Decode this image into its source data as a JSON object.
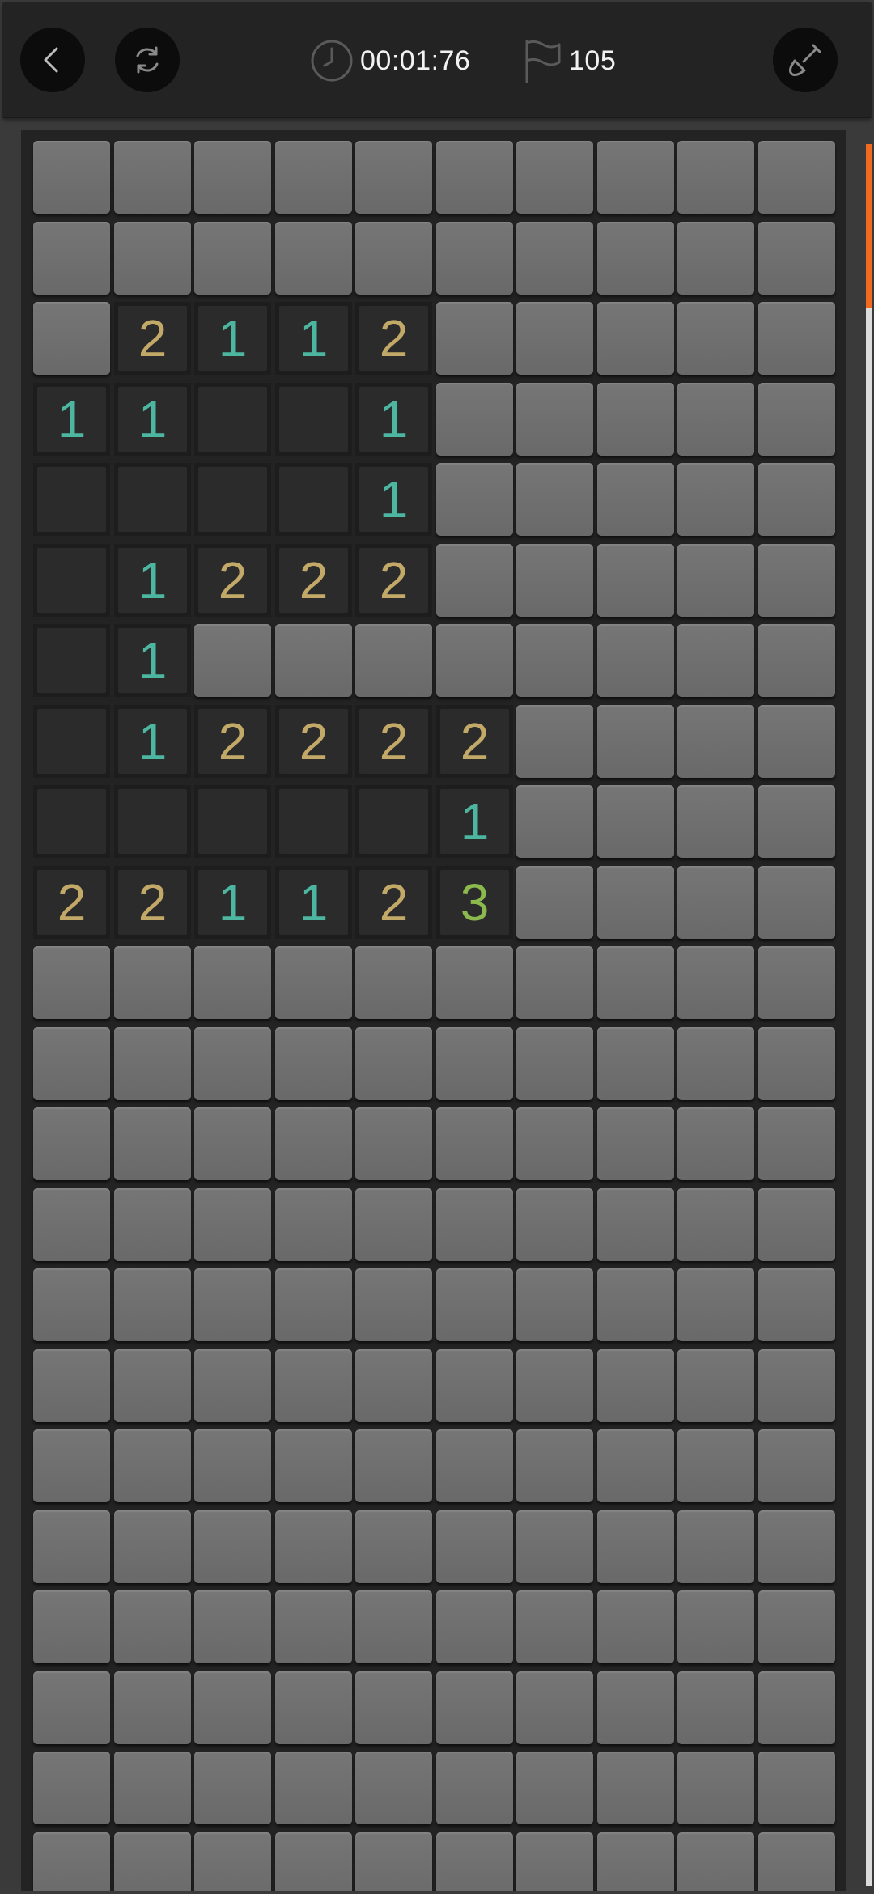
{
  "header": {
    "timer": "00:01:76",
    "flags": "105",
    "icons": {
      "back": "back-arrow-icon",
      "restart": "restart-icon",
      "dig": "shovel-icon",
      "clock": "clock-icon",
      "flag": "flag-icon"
    }
  },
  "board": {
    "cols": 10,
    "visible_rows": 23,
    "rows": [
      [
        "",
        "",
        "",
        "",
        "",
        "",
        "",
        "",
        "",
        ""
      ],
      [
        "",
        "",
        "",
        "",
        "",
        "",
        "",
        "",
        "",
        ""
      ],
      [
        "",
        "2",
        "1",
        "1",
        "2",
        "",
        "",
        "",
        "",
        ""
      ],
      [
        "1",
        "1",
        "0",
        "0",
        "1",
        "",
        "",
        "",
        "",
        ""
      ],
      [
        "0",
        "0",
        "0",
        "0",
        "1",
        "",
        "",
        "",
        "",
        ""
      ],
      [
        "0",
        "1",
        "2",
        "2",
        "2",
        "",
        "",
        "",
        "",
        ""
      ],
      [
        "0",
        "1",
        "",
        "",
        "",
        "",
        "",
        "",
        "",
        ""
      ],
      [
        "0",
        "1",
        "2",
        "2",
        "2",
        "2",
        "",
        "",
        "",
        ""
      ],
      [
        "0",
        "0",
        "0",
        "0",
        "0",
        "1",
        "",
        "",
        "",
        ""
      ],
      [
        "2",
        "2",
        "1",
        "1",
        "2",
        "3",
        "",
        "",
        "",
        ""
      ],
      [
        "",
        "",
        "",
        "",
        "",
        "",
        "",
        "",
        "",
        ""
      ],
      [
        "",
        "",
        "",
        "",
        "",
        "",
        "",
        "",
        "",
        ""
      ],
      [
        "",
        "",
        "",
        "",
        "",
        "",
        "",
        "",
        "",
        ""
      ],
      [
        "",
        "",
        "",
        "",
        "",
        "",
        "",
        "",
        "",
        ""
      ],
      [
        "",
        "",
        "",
        "",
        "",
        "",
        "",
        "",
        "",
        ""
      ],
      [
        "",
        "",
        "",
        "",
        "",
        "",
        "",
        "",
        "",
        ""
      ],
      [
        "",
        "",
        "",
        "",
        "",
        "",
        "",
        "",
        "",
        ""
      ],
      [
        "",
        "",
        "",
        "",
        "",
        "",
        "",
        "",
        "",
        ""
      ],
      [
        "",
        "",
        "",
        "",
        "",
        "",
        "",
        "",
        "",
        ""
      ],
      [
        "",
        "",
        "",
        "",
        "",
        "",
        "",
        "",
        "",
        ""
      ],
      [
        "",
        "",
        "",
        "",
        "",
        "",
        "",
        "",
        "",
        ""
      ],
      [
        "",
        "",
        "",
        "",
        "",
        "",
        "",
        "",
        "",
        ""
      ],
      [
        "",
        "",
        "",
        "",
        "",
        "",
        "",
        "",
        "",
        ""
      ]
    ],
    "legend": "\"\" = unrevealed tile, \"0\" = revealed empty tile, digit = revealed number"
  },
  "colors": {
    "one": "#4db6a1",
    "two": "#c2a968",
    "three": "#8cb94d",
    "scroll_thumb": "#f06a21"
  },
  "scroll": {
    "position_fraction": 0.0
  }
}
